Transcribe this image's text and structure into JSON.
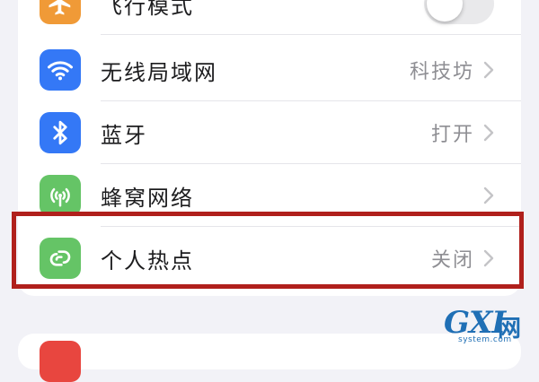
{
  "settings": {
    "rows": [
      {
        "label": "飞行模式",
        "value": "",
        "icon": "airplane-icon",
        "icon_color": "#f09a37",
        "control": "toggle",
        "toggle_on": false
      },
      {
        "label": "无线局域网",
        "value": "科技坊",
        "icon": "wifi-icon",
        "icon_color": "#3478f6",
        "control": "chevron"
      },
      {
        "label": "蓝牙",
        "value": "打开",
        "icon": "bluetooth-icon",
        "icon_color": "#3478f6",
        "control": "chevron"
      },
      {
        "label": "蜂窝网络",
        "value": "",
        "icon": "cellular-antenna-icon",
        "icon_color": "#65c466",
        "control": "chevron"
      },
      {
        "label": "个人热点",
        "value": "关闭",
        "icon": "personal-hotspot-icon",
        "icon_color": "#65c466",
        "control": "chevron",
        "highlighted": true
      }
    ]
  },
  "next_group": {
    "icon": "notifications-icon",
    "icon_color": "#e8463f"
  },
  "highlight_color": "#b0201c",
  "watermark": {
    "letters": "GXI",
    "cn": "网",
    "url": "system.com"
  }
}
